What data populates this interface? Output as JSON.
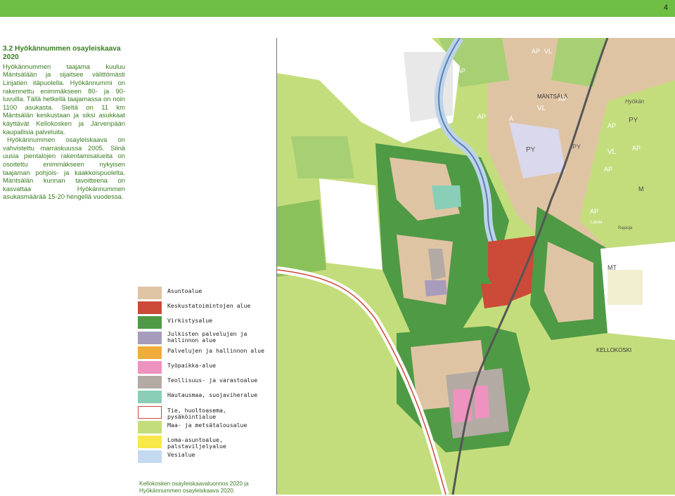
{
  "header": {
    "page_number": "4",
    "bar_color": "#6fbf45"
  },
  "article": {
    "heading": "3.2 Hyökännummen osayleiskaava 2020",
    "paragraphs": [
      "Hyökännummen taajama kuuluu Mäntsälään ja sijaitsee välittömästi Linjatien itäpuolella. Hyökännummi on rakennettu enimmäkseen 80- ja 90-luvuilla. Tällä hetkellä taajamassa on noin 1100 asukasta. Sieltä on 11 km Mäntsälän keskustaan ja siksi asukkaat käyttävät Kellokosken ja Järvenpään kaupallisia palveluita.",
      "Hyökännummen osayleiskaava on vahvistettu marraskuussa 2005. Siinä uusia pientalojen rakentamisalueita on osoitettu enimmäkseen nykyisen taajaman pohjois- ja kaakkoispuolelta. Mäntsälän kunnan tavoitteena on kasvattaa Hyökännummen asukasmäärää 15-20 hengellä vuodessa."
    ]
  },
  "legend": {
    "items": [
      {
        "label": "Asuntoalue",
        "color": "#dfc4a4"
      },
      {
        "label": "Keskustatoimintojen alue",
        "color": "#cc4a38"
      },
      {
        "label": "Virkistysalue",
        "color": "#4f9a44"
      },
      {
        "label": "Julkisten palvelujen ja\nhallinnon alue",
        "color": "#a89cbc"
      },
      {
        "label": "Palvelujen ja hallinnon alue",
        "color": "#f0ad3c"
      },
      {
        "label": "Työpaikka-alue",
        "color": "#ee93bf"
      },
      {
        "label": "Teollisuus- ja varastoalue",
        "color": "#b3aaa3"
      },
      {
        "label": "Hautausmaa, suojaviheralue",
        "color": "#89cfb7"
      },
      {
        "label": "Tie, huoltoasema, pysäköintialue",
        "color": "#ffffff",
        "border": "#cc4a38"
      },
      {
        "label": "Maa- ja metsätalousalue",
        "color": "#c4dd7c"
      },
      {
        "label": "Loma-asuntoalue, palstaviljelyalue",
        "color": "#f8e84a"
      },
      {
        "label": "Vesialue",
        "color": "#c3d9f0"
      }
    ]
  },
  "map": {
    "labels": {
      "mantsala": "MÄNTSÄLÄ",
      "kellokoski": "KELLOKOSKI",
      "hyokan": "Hyökän",
      "ap": "AP",
      "vl": "VL",
      "py": "PY",
      "a": "A",
      "m": "M",
      "mt": "MT",
      "latola": "Latola",
      "rajaoja": "Rajaoja"
    }
  },
  "caption": "Kellokosken osayleiskaavaluonnos 2020 ja Hyökännummen osayleiskaava 2020."
}
